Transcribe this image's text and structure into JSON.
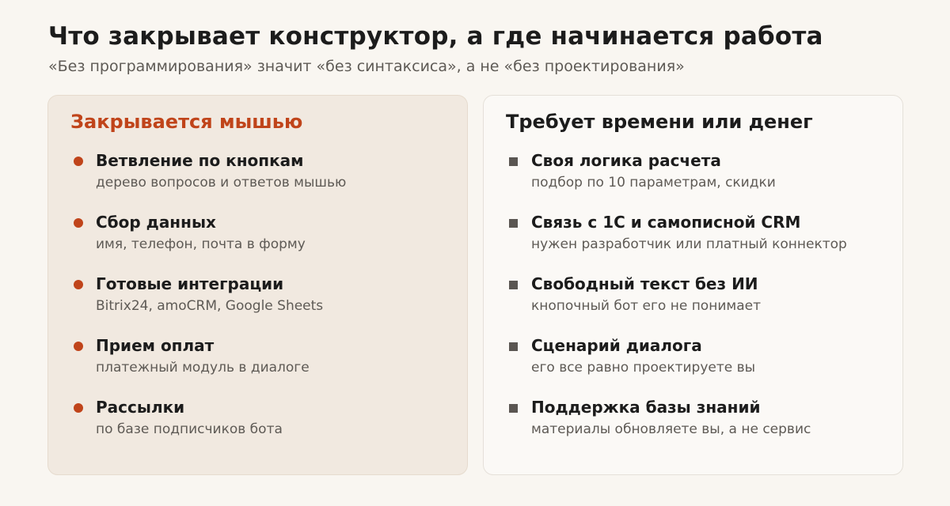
{
  "header": {
    "title": "Что закрывает конструктор, а где начинается работа",
    "subtitle": "«Без программирования» значит «без синтаксиса», а не «без проектирования»"
  },
  "left_panel": {
    "title": "Закрывается мышью",
    "accent_color": "#c0441a",
    "marker_icon": "dot-bullet",
    "items": [
      {
        "title": "Ветвление по кнопкам",
        "desc": "дерево вопросов и ответов мышью"
      },
      {
        "title": "Сбор данных",
        "desc": "имя, телефон, почта в форму"
      },
      {
        "title": "Готовые интеграции",
        "desc": "Bitrix24, amoCRM, Google Sheets"
      },
      {
        "title": "Прием оплат",
        "desc": "платежный модуль в диалоге"
      },
      {
        "title": "Рассылки",
        "desc": "по базе подписчиков бота"
      }
    ]
  },
  "right_panel": {
    "title": "Требует времени или денег",
    "marker_icon": "square-bullet",
    "items": [
      {
        "title": "Своя логика расчета",
        "desc": "подбор по 10 параметрам, скидки"
      },
      {
        "title": "Связь с 1С и самописной CRM",
        "desc": "нужен разработчик или платный коннектор"
      },
      {
        "title": "Свободный текст без ИИ",
        "desc": "кнопочный бот его не понимает"
      },
      {
        "title": "Сценарий диалога",
        "desc": "его все равно проектируете вы"
      },
      {
        "title": "Поддержка базы знаний",
        "desc": "материалы обновляете вы, а не сервис"
      }
    ]
  }
}
